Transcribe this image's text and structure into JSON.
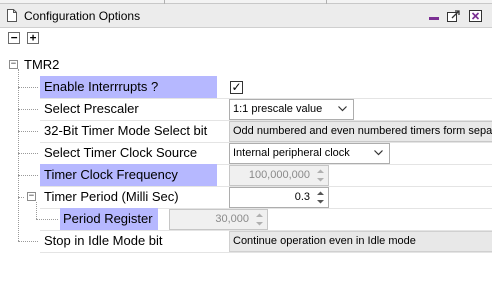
{
  "window": {
    "title": "Configuration Options"
  },
  "toolbar": {
    "collapse_all_glyph": "−",
    "expand_all_glyph": "+"
  },
  "icons": {
    "document": "document-icon",
    "minimize": "minimize-icon",
    "undock": "undock-icon",
    "close": "close-icon",
    "dropdown": "chevron-down-icon",
    "spin_up": "spin-up-icon",
    "spin_down": "spin-down-icon"
  },
  "colors": {
    "highlight": "#b6b8ff",
    "accent": "#7b2f93"
  },
  "tree": {
    "root": {
      "label": "TMR2",
      "expanded": true
    },
    "enable_interrupts": {
      "label": "Enable Interrrupts ?",
      "checked": true,
      "check_glyph": "✓"
    },
    "prescaler": {
      "label": "Select Prescaler",
      "value": "1:1 prescale value"
    },
    "mode_32bit": {
      "label": "32-Bit Timer Mode Select bit",
      "value": "Odd numbered and even numbered timers form separ"
    },
    "clock_source": {
      "label": "Select Timer Clock Source",
      "value": "Internal peripheral clock"
    },
    "clock_freq": {
      "label": "Timer Clock Frequency",
      "value": "100,000,000"
    },
    "timer_period": {
      "label": "Timer Period (Milli Sec)",
      "value": "0.3",
      "expanded": true
    },
    "period_register": {
      "label": "Period Register",
      "value": "30,000"
    },
    "idle_mode": {
      "label": "Stop in Idle Mode bit",
      "value": "Continue operation even in Idle mode"
    }
  }
}
